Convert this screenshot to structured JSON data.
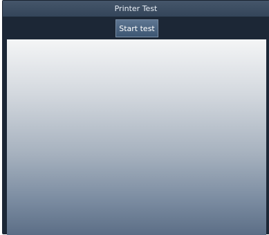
{
  "window": {
    "title": "Printer Test"
  },
  "toolbar": {
    "start_label": "Start test"
  },
  "colors": {
    "frame": "#1c2736",
    "titlebar": "#3d4e63",
    "button": "#4f6783"
  }
}
